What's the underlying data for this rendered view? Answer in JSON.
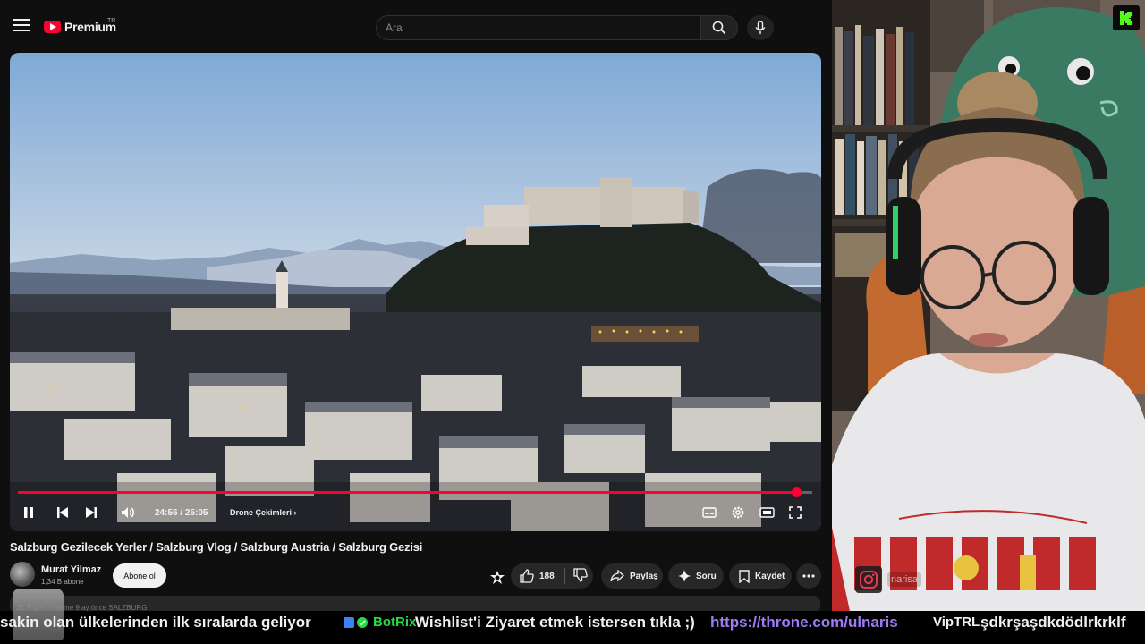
{
  "youtube": {
    "logo_text": "Premium",
    "logo_country": "TR",
    "search_placeholder": "Ara",
    "player": {
      "progress_fraction": 0.98,
      "time_display": "24:56 / 25:05",
      "chapter_label": "Drone Çekimleri"
    },
    "video_title": "Salzburg Gezilecek Yerler / Salzburg Vlog / Salzburg Austria / Salzburg Gezisi",
    "channel": {
      "name": "Murat Yilmaz",
      "subscribers": "1,34 B abone",
      "subscribe_label": "Abone ol"
    },
    "actions": {
      "likes": "188",
      "share_label": "Paylaş",
      "ask_label": "Soru",
      "save_label": "Kaydet"
    },
    "description_peek": "31 B görüntüleme  9 ay önce  SALZBURG"
  },
  "overlay": {
    "instagram_handle": "narisa"
  },
  "ticker": {
    "segment1": "sakin olan ülkelerinden ilk sıralarda geliyor",
    "bot_name": "BotRix",
    "segment2": "Wishlist'i Ziyaret etmek istersen tıkla ;)",
    "link": "https://throne.com/ulnaris",
    "user": "VipTRL",
    "segment3": "şdkrşaşdkdödlrkrklf"
  },
  "colors": {
    "accent_red": "#ff0033",
    "link_purple": "#9d7cf5",
    "botrix_green": "#22dd44",
    "kick_green": "#53fc18"
  }
}
